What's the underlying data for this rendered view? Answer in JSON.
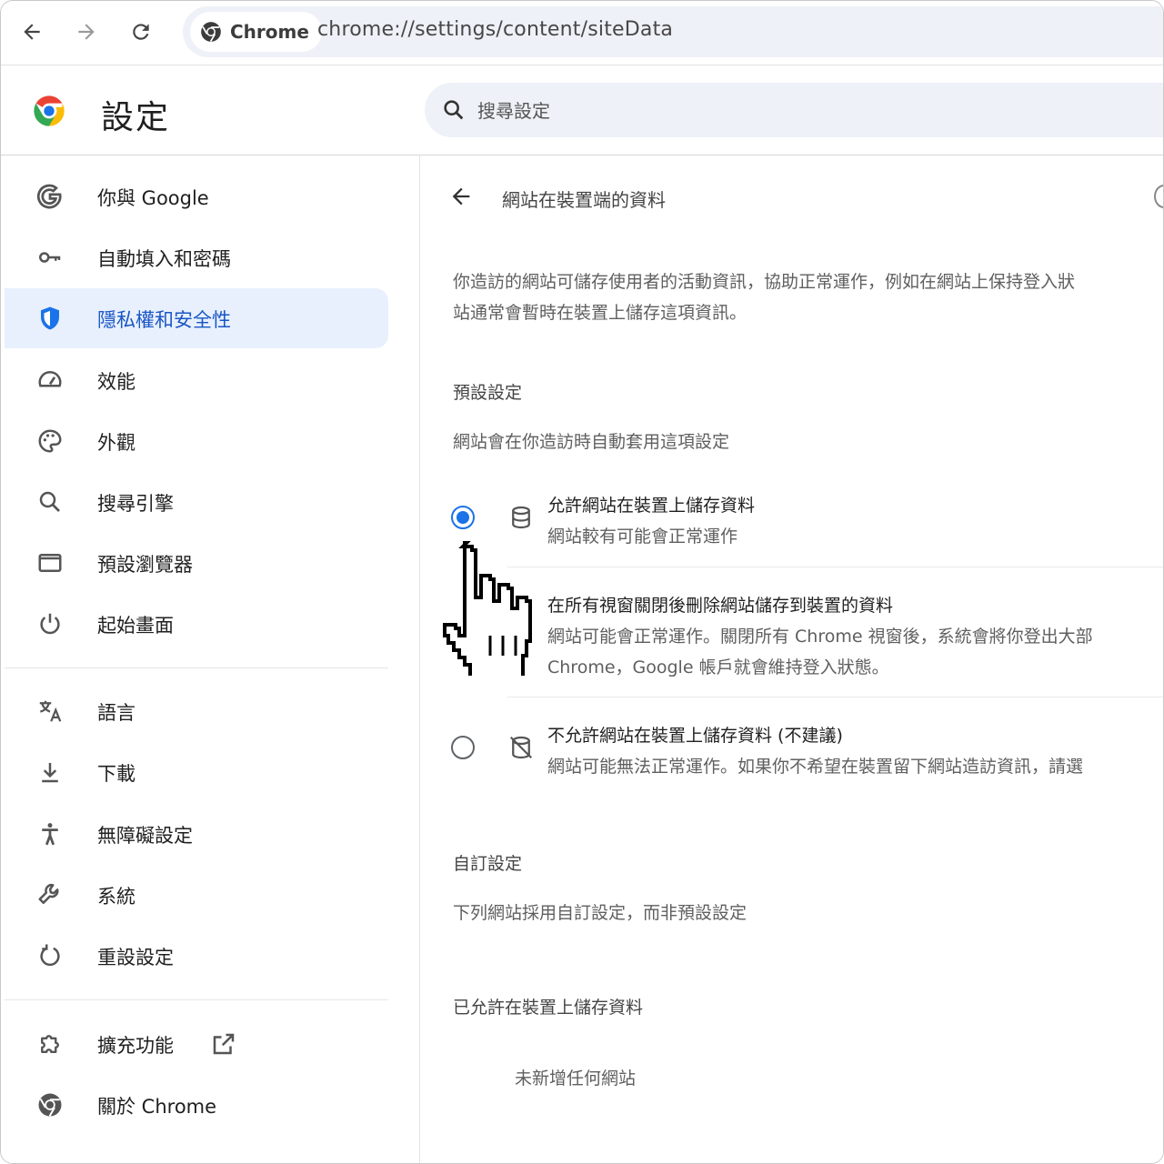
{
  "browser": {
    "chip_label": "Chrome",
    "url": "chrome://settings/content/siteData",
    "icons": [
      "back-arrow-icon",
      "forward-arrow-icon",
      "reload-icon",
      "chrome-logo-icon"
    ]
  },
  "header": {
    "title": "設定",
    "search_placeholder": "搜尋設定"
  },
  "sidebar": {
    "items": [
      {
        "label": "你與 Google",
        "icon": "google-g-icon"
      },
      {
        "label": "自動填入和密碼",
        "icon": "key-icon"
      },
      {
        "label": "隱私權和安全性",
        "icon": "shield-icon",
        "active": true
      },
      {
        "label": "效能",
        "icon": "gauge-icon"
      },
      {
        "label": "外觀",
        "icon": "palette-icon"
      },
      {
        "label": "搜尋引擎",
        "icon": "search-icon"
      },
      {
        "label": "預設瀏覽器",
        "icon": "browser-window-icon"
      },
      {
        "label": "起始畫面",
        "icon": "power-icon"
      },
      {
        "label": "語言",
        "icon": "translate-icon"
      },
      {
        "label": "下載",
        "icon": "download-icon"
      },
      {
        "label": "無障礙設定",
        "icon": "accessibility-icon"
      },
      {
        "label": "系統",
        "icon": "wrench-icon"
      },
      {
        "label": "重設設定",
        "icon": "reset-icon"
      },
      {
        "label": "擴充功能",
        "icon": "puzzle-icon"
      },
      {
        "label": "關於 Chrome",
        "icon": "chrome-logo-icon"
      }
    ]
  },
  "main": {
    "title": "網站在裝置端的資料",
    "description": [
      "你造訪的網站可儲存使用者的活動資訊，協助正常運作，例如在網站上保持登入狀",
      "站通常會暫時在裝置上儲存這項資訊。"
    ],
    "default_heading": "預設設定",
    "default_sub": "網站會在你造訪時自動套用這項設定",
    "options": [
      {
        "title": "允許網站在裝置上儲存資料",
        "sub": "網站較有可能會正常運作",
        "checked": true,
        "icon": "database-icon"
      },
      {
        "title": "在所有視窗關閉後刪除網站儲存到裝置的資料",
        "sub": "網站可能會正常運作。關閉所有 Chrome 視窗後，系統會將你登出大部",
        "sub2": "Chrome，Google 帳戶就會維持登入狀態。",
        "checked": false
      },
      {
        "title": "不允許網站在裝置上儲存資料 (不建議)",
        "sub": "網站可能無法正常運作。如果你不希望在裝置留下網站造訪資訊，請選",
        "checked": false,
        "icon": "database-off-icon"
      }
    ],
    "custom_heading": "自訂設定",
    "custom_sub": "下列網站採用自訂設定，而非預設設定",
    "allowed_heading": "已允許在裝置上儲存資料",
    "allowed_empty": "未新增任何網站"
  },
  "colors": {
    "accent": "#1a73e8",
    "active_bg": "#e8f0fe",
    "active_text": "#1a56c4",
    "omnibox_bg": "#eef1f7"
  }
}
